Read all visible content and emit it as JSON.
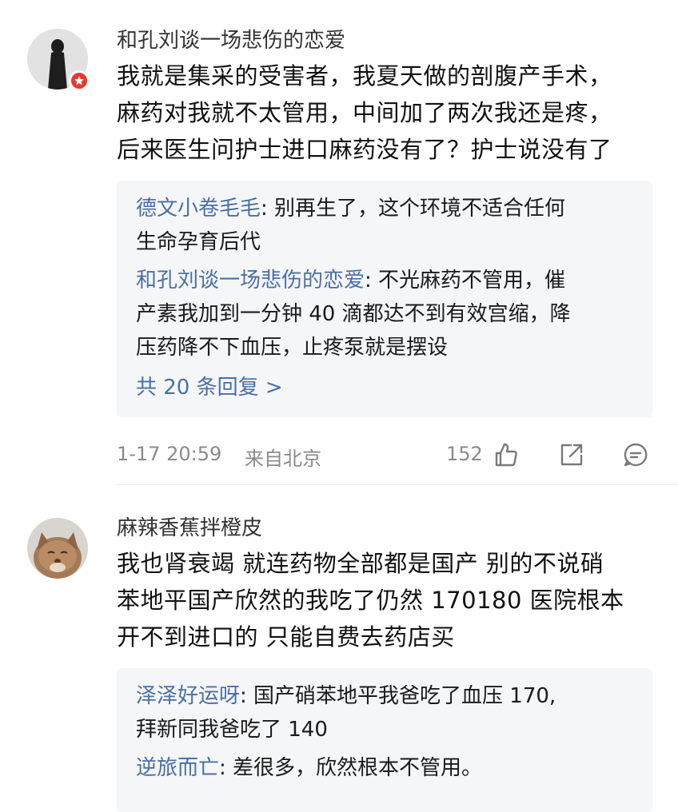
{
  "comments": [
    {
      "username": "和孔刘谈一场悲伤的恋爱",
      "avatar": "person-silhouette-avatar",
      "badge": "red-star-badge-icon",
      "body_lines": [
        "我就是集采的受害者，我夏天做的剖腹产手术，",
        "麻药对我就不太管用，中间加了两次我还是疼，",
        "后来医生问护士进口麻药没有了？护士说没有了"
      ],
      "replies": [
        {
          "name": "德文小卷毛毛",
          "line1": ": 别再生了，这个环境不适合任何",
          "line2": "生命孕育后代"
        },
        {
          "name": "和孔刘谈一场悲伤的恋爱",
          "line1": ": 不光麻药不管用，催",
          "line2": "产素我加到一分钟 40 滴都达不到有效宫缩，降",
          "line3": "压药降不下血压，止疼泵就是摆设"
        }
      ],
      "more_replies": "共 20 条回复 >",
      "time": "1-17 20:59",
      "location": "来自北京",
      "like_count": "152"
    },
    {
      "username": "麻辣香蕉拌橙皮",
      "avatar": "cat-photo-avatar",
      "body_lines": [
        "我也肾衰竭 就连药物全部都是国产 别的不说硝",
        "苯地平国产欣然的我吃了仍然 170180 医院根本",
        "开不到进口的 只能自费去药店买"
      ],
      "replies": [
        {
          "name": "泽泽好运呀",
          "line1": ": 国产硝苯地平我爸吃了血压 170,",
          "line2": "拜新同我爸吃了 140"
        },
        {
          "name": "逆旅而亡",
          "line1": ": 差很多，欣然根本不管用。"
        }
      ]
    }
  ],
  "icons": {
    "like": "thumbs-up-icon",
    "share": "share-icon",
    "reply": "comment-icon"
  },
  "colors": {
    "link_blue": "#4a6fa5",
    "badge_red": "#e8392c",
    "reply_bg": "#f5f6f8",
    "meta_gray": "#8a8a8a"
  }
}
